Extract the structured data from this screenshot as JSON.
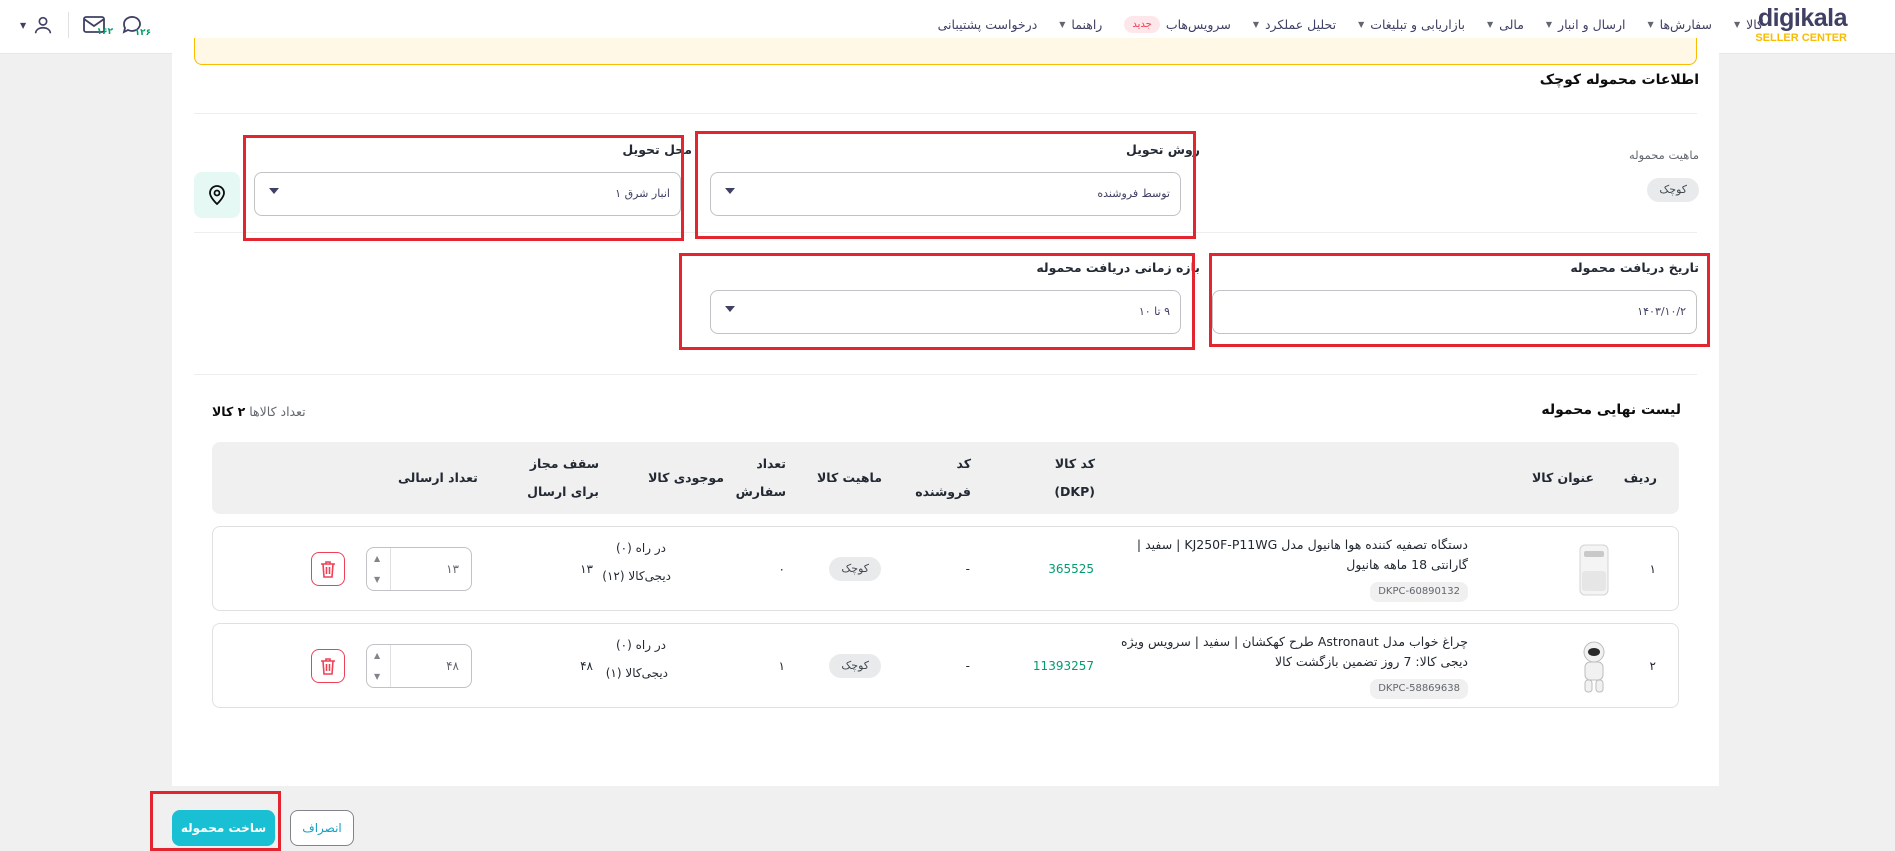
{
  "brand": {
    "name": "digikala",
    "sub": "SELLER CENTER",
    "color": "#3f4064",
    "accent": "#f9bc00"
  },
  "nav": {
    "items": [
      {
        "label": "کالا"
      },
      {
        "label": "سفارش‌ها"
      },
      {
        "label": "ارسال و انبار"
      },
      {
        "label": "مالی"
      },
      {
        "label": "بازاریابی و تبلیغات"
      },
      {
        "label": "تحلیل عملکرد"
      },
      {
        "label": "سرویس‌هاب",
        "badge": "جدید"
      },
      {
        "label": "راهنما"
      },
      {
        "label": "درخواست پشتیبانی"
      }
    ]
  },
  "top_icons": {
    "support_count": "۱۲۶",
    "messages_count": "۱۶۲"
  },
  "section": {
    "title": "اطلاعات محموله کوچک"
  },
  "form": {
    "nature_label": "ماهیت محموله",
    "nature_value": "کوچک",
    "delivery_method_label": "روش تحویل",
    "delivery_method_value": "توسط فروشنده",
    "delivery_place_label": "محل تحویل",
    "delivery_place_value": "انبار شرق ۱",
    "receive_date_label": "تاریخ دریافت محموله",
    "receive_date_value": "۱۴۰۳/۱۰/۲",
    "receive_time_label": "بازه زمانی دریافت محموله",
    "receive_time_value": "۹ تا ۱۰"
  },
  "final_list": {
    "title": "لیست نهایی محموله",
    "count_label": "تعداد کالاها",
    "count_value": "۲ کالا",
    "columns": {
      "row": "ردیف",
      "title": "عنوان کالا",
      "dkp_1": "کد کالا",
      "dkp_2": "(DKP)",
      "seller_code_1": "کد",
      "seller_code_2": "فروشنده",
      "nature": "ماهیت کالا",
      "order_count_1": "تعداد",
      "order_count_2": "سفارش",
      "stock": "موجودی کالا",
      "cap_1": "سقف مجاز",
      "cap_2": "برای ارسال",
      "send_count": "تعداد ارسالی"
    },
    "rows": [
      {
        "index": "۱",
        "title_line1": "دستگاه تصفیه کننده هوا هانیول مدل KJ250F-P11WG | سفید |",
        "title_line2": "گارانتی 18 ماهه هانیول",
        "dkpc": "DKPC-60890132",
        "dkp": "365525",
        "seller_code": "-",
        "nature": "کوچک",
        "order_count": "۰",
        "stock_line1": "در راه (۰)",
        "stock_line2": "دیجی‌کالا (۱۲)",
        "cap": "۱۳",
        "send_count": "۱۳"
      },
      {
        "index": "۲",
        "title_line1": "چراغ خواب مدل Astronaut طرح کهکشان | سفید | سرویس ویژه",
        "title_line2": "دیجی کالا: 7 روز تضمین بازگشت کالا",
        "dkpc": "DKPC-58869638",
        "dkp": "11393257",
        "seller_code": "-",
        "nature": "کوچک",
        "order_count": "۱",
        "stock_line1": "در راه (۰)",
        "stock_line2": "دیجی‌کالا (۱)",
        "cap": "۴۸",
        "send_count": "۴۸"
      }
    ]
  },
  "actions": {
    "create": "ساخت محموله",
    "cancel": "انصراف"
  },
  "colors": {
    "primary": "#19bfd3",
    "green": "#019d6e",
    "danger": "#ef4056",
    "highlight": "#e3252f"
  }
}
